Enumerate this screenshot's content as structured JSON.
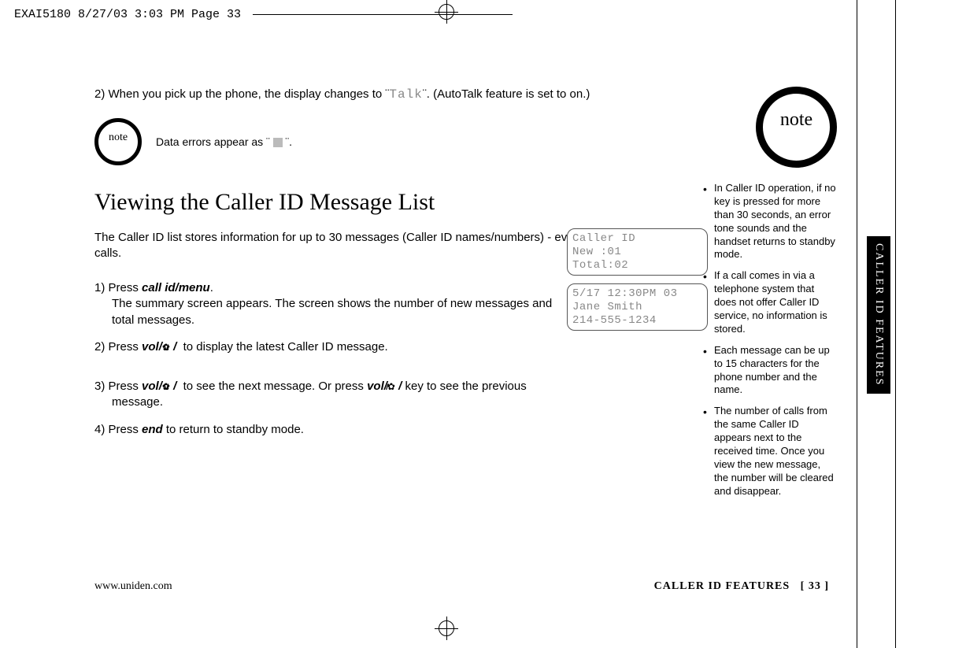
{
  "header": {
    "slug": "EXAI5180  8/27/03 3:03 PM  Page 33"
  },
  "main": {
    "step2_top": "2) When you pick up the phone, the display changes to ¨",
    "talk": "Talk",
    "step2_top_tail": "¨. (AutoTalk feature is set to on.)",
    "note_small_label": "note",
    "data_errors_pre": "Data errors appear as ¨ ",
    "data_errors_post": " ¨.",
    "title": "Viewing the Caller ID Message List",
    "intro": "The Caller ID list stores information for up to 30 messages (Caller ID names/numbers) - even unanswered calls.",
    "s1_pre": "1) Press ",
    "s1_key": "call id/menu",
    "s1_post": ".",
    "s1_desc": "The summary screen appears. The screen shows the number of new messages and total messages.",
    "s2_pre": "2) Press ",
    "s2_key": "vol/",
    "s2_mid": " / ",
    "s2_post": " to display the latest Caller ID message.",
    "s3_pre": "3) Press ",
    "s3_key": "vol/",
    "s3_mid1": " / ",
    "s3_mid2": " to see the next message. Or press ",
    "s3_key2": "vol/",
    "s3_mid3": " /",
    "s3_post": " key to see the previous message.",
    "s4_pre": "4) Press ",
    "s4_key": "end",
    "s4_post": " to return to standby mode."
  },
  "lcd": {
    "l1a": " Caller ID",
    "l1b": " New  :01",
    "l1c": " Total:02",
    "l2a": " 5/17 12:30PM 03",
    "l2b": "Jane Smith",
    "l2c": "214-555-1234"
  },
  "sidebar": {
    "note_label": "note",
    "b1": "In Caller ID operation, if no key is pressed for more than 30 seconds, an error tone sounds and the handset returns to standby mode.",
    "b2": "If a call comes in via a telephone system that does not offer Caller ID service, no information is stored.",
    "b3": "Each message can be up to 15 characters for the phone number and the name.",
    "b4": "The number of calls from the same Caller ID appears next to the received time. Once you view the new message, the number will be cleared and disappear."
  },
  "side_tab": "CALLER ID FEATURES",
  "footer": {
    "left": "www.uniden.com",
    "right_label": "CALLER ID FEATURES",
    "right_page": "[ 33 ]"
  }
}
